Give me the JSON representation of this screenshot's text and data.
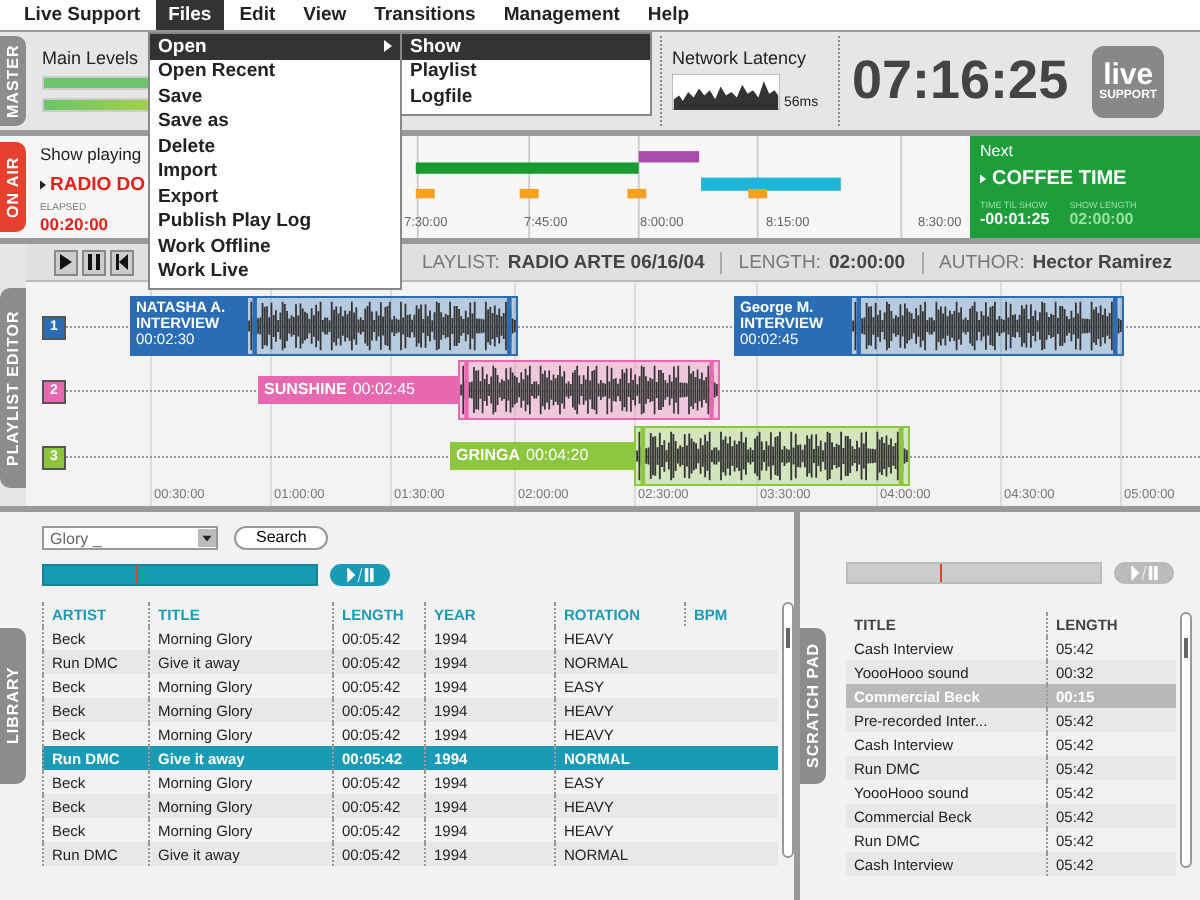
{
  "menubar": {
    "items": [
      {
        "label": "Live Support",
        "selected": false
      },
      {
        "label": "Files",
        "selected": true
      },
      {
        "label": "Edit",
        "selected": false
      },
      {
        "label": "View",
        "selected": false
      },
      {
        "label": "Transitions",
        "selected": false
      },
      {
        "label": "Management",
        "selected": false
      },
      {
        "label": "Help",
        "selected": false
      }
    ]
  },
  "files_menu": {
    "items": [
      {
        "label": "Open",
        "selected": true,
        "submenu": true
      },
      {
        "label": "Open Recent",
        "selected": false,
        "submenu": false
      },
      {
        "label": "Save",
        "selected": false,
        "submenu": false
      },
      {
        "label": "Save as",
        "selected": false,
        "submenu": false
      },
      {
        "label": "Delete",
        "selected": false,
        "submenu": false
      },
      {
        "label": "Import",
        "selected": false,
        "submenu": false
      },
      {
        "label": "Export",
        "selected": false,
        "submenu": false
      },
      {
        "label": "Publish Play Log",
        "selected": false,
        "submenu": false
      },
      {
        "label": "Work Offline",
        "selected": false,
        "submenu": false
      },
      {
        "label": "Work Live",
        "selected": false,
        "submenu": false
      }
    ]
  },
  "open_submenu": {
    "items": [
      {
        "label": "Show",
        "selected": true
      },
      {
        "label": "Playlist",
        "selected": false
      },
      {
        "label": "Logfile",
        "selected": false
      }
    ]
  },
  "master": {
    "tab": "MASTER",
    "levels_label": "Main Levels",
    "meters": [
      {
        "level": 0.45
      },
      {
        "level": 0.8
      }
    ],
    "latency_label": "Network Latency",
    "latency": "56ms",
    "clock": "07:16:25",
    "logo_top": "live",
    "logo_bottom": "SUPPORT"
  },
  "on_air": {
    "tab": "ON AIR",
    "label": "Show playing",
    "show": "RADIO DO",
    "elapsed_label": "ELAPSED",
    "elapsed": "00:20:00",
    "ticks": [
      "7:30:00",
      "7:45:00",
      "8:00:00",
      "8:15:00",
      "8:30:00"
    ],
    "next": {
      "label": "Next",
      "show": "COFFEE TIME",
      "time_til_label": "TIME TIL SHOW",
      "time_til": "-00:01:25",
      "length_label": "SHOW LENGTH",
      "length": "02:00:00"
    }
  },
  "playlist_editor": {
    "tab": "PLAYLIST EDITOR",
    "playlist_label": "LAYLIST:",
    "playlist": "RADIO ARTE 06/16/04",
    "length_label": "LENGTH:",
    "length": "02:00:00",
    "author_label": "AUTHOR:",
    "author": "Hector Ramirez",
    "tracks": [
      {
        "number": "1",
        "color": "#2a6db5",
        "clips": [
          {
            "title": "NATASHA A. INTERVIEW",
            "time": "00:02:30"
          },
          {
            "title": "George M. INTERVIEW",
            "time": "00:02:45"
          }
        ]
      },
      {
        "number": "2",
        "color": "#e868b0",
        "clips": [
          {
            "title": "SUNSHINE",
            "time": "00:02:45"
          }
        ]
      },
      {
        "number": "3",
        "color": "#8cc63e",
        "clips": [
          {
            "title": "GRINGA",
            "time": "00:04:20"
          }
        ]
      }
    ],
    "axis": [
      "00:30:00",
      "01:00:00",
      "01:30:00",
      "02:00:00",
      "02:30:00",
      "03:30:00",
      "04:00:00",
      "04:30:00",
      "05:00:00"
    ]
  },
  "library": {
    "tab": "LIBRARY",
    "search_value": "Glory _",
    "search_button": "Search",
    "columns": [
      "ARTIST",
      "TITLE",
      "LENGTH",
      "YEAR",
      "ROTATION",
      "BPM"
    ],
    "rows": [
      {
        "cells": [
          "Beck",
          "Morning Glory",
          "00:05:42",
          "1994",
          "HEAVY"
        ],
        "selected": false
      },
      {
        "cells": [
          "Run DMC",
          "Give it away",
          "00:05:42",
          "1994",
          "NORMAL"
        ],
        "selected": false
      },
      {
        "cells": [
          "Beck",
          "Morning Glory",
          "00:05:42",
          "1994",
          "EASY"
        ],
        "selected": false
      },
      {
        "cells": [
          "Beck",
          "Morning Glory",
          "00:05:42",
          "1994",
          "HEAVY"
        ],
        "selected": false
      },
      {
        "cells": [
          "Beck",
          "Morning Glory",
          "00:05:42",
          "1994",
          "HEAVY"
        ],
        "selected": false
      },
      {
        "cells": [
          "Run DMC",
          "Give it away",
          "00:05:42",
          "1994",
          "NORMAL"
        ],
        "selected": true
      },
      {
        "cells": [
          "Beck",
          "Morning Glory",
          "00:05:42",
          "1994",
          "EASY"
        ],
        "selected": false
      },
      {
        "cells": [
          "Beck",
          "Morning Glory",
          "00:05:42",
          "1994",
          "HEAVY"
        ],
        "selected": false
      },
      {
        "cells": [
          "Beck",
          "Morning Glory",
          "00:05:42",
          "1994",
          "HEAVY"
        ],
        "selected": false
      },
      {
        "cells": [
          "Run DMC",
          "Give it away",
          "00:05:42",
          "1994",
          "NORMAL"
        ],
        "selected": false
      }
    ]
  },
  "scratch_pad": {
    "tab": "SCRATCH PAD",
    "columns": [
      "TITLE",
      "LENGTH"
    ],
    "rows": [
      {
        "cells": [
          "Cash Interview",
          "05:42"
        ],
        "selected": false
      },
      {
        "cells": [
          "YoooHooo sound",
          "00:32"
        ],
        "selected": false
      },
      {
        "cells": [
          "Commercial Beck",
          "00:15"
        ],
        "selected": true
      },
      {
        "cells": [
          "Pre-recorded Inter...",
          "05:42"
        ],
        "selected": false
      },
      {
        "cells": [
          "Cash Interview",
          "05:42"
        ],
        "selected": false
      },
      {
        "cells": [
          "Run DMC",
          "05:42"
        ],
        "selected": false
      },
      {
        "cells": [
          "YoooHooo sound",
          "05:42"
        ],
        "selected": false
      },
      {
        "cells": [
          "Commercial Beck",
          "05:42"
        ],
        "selected": false
      },
      {
        "cells": [
          "Run DMC",
          "05:42"
        ],
        "selected": false
      },
      {
        "cells": [
          "Cash Interview",
          "05:42"
        ],
        "selected": false
      }
    ]
  }
}
